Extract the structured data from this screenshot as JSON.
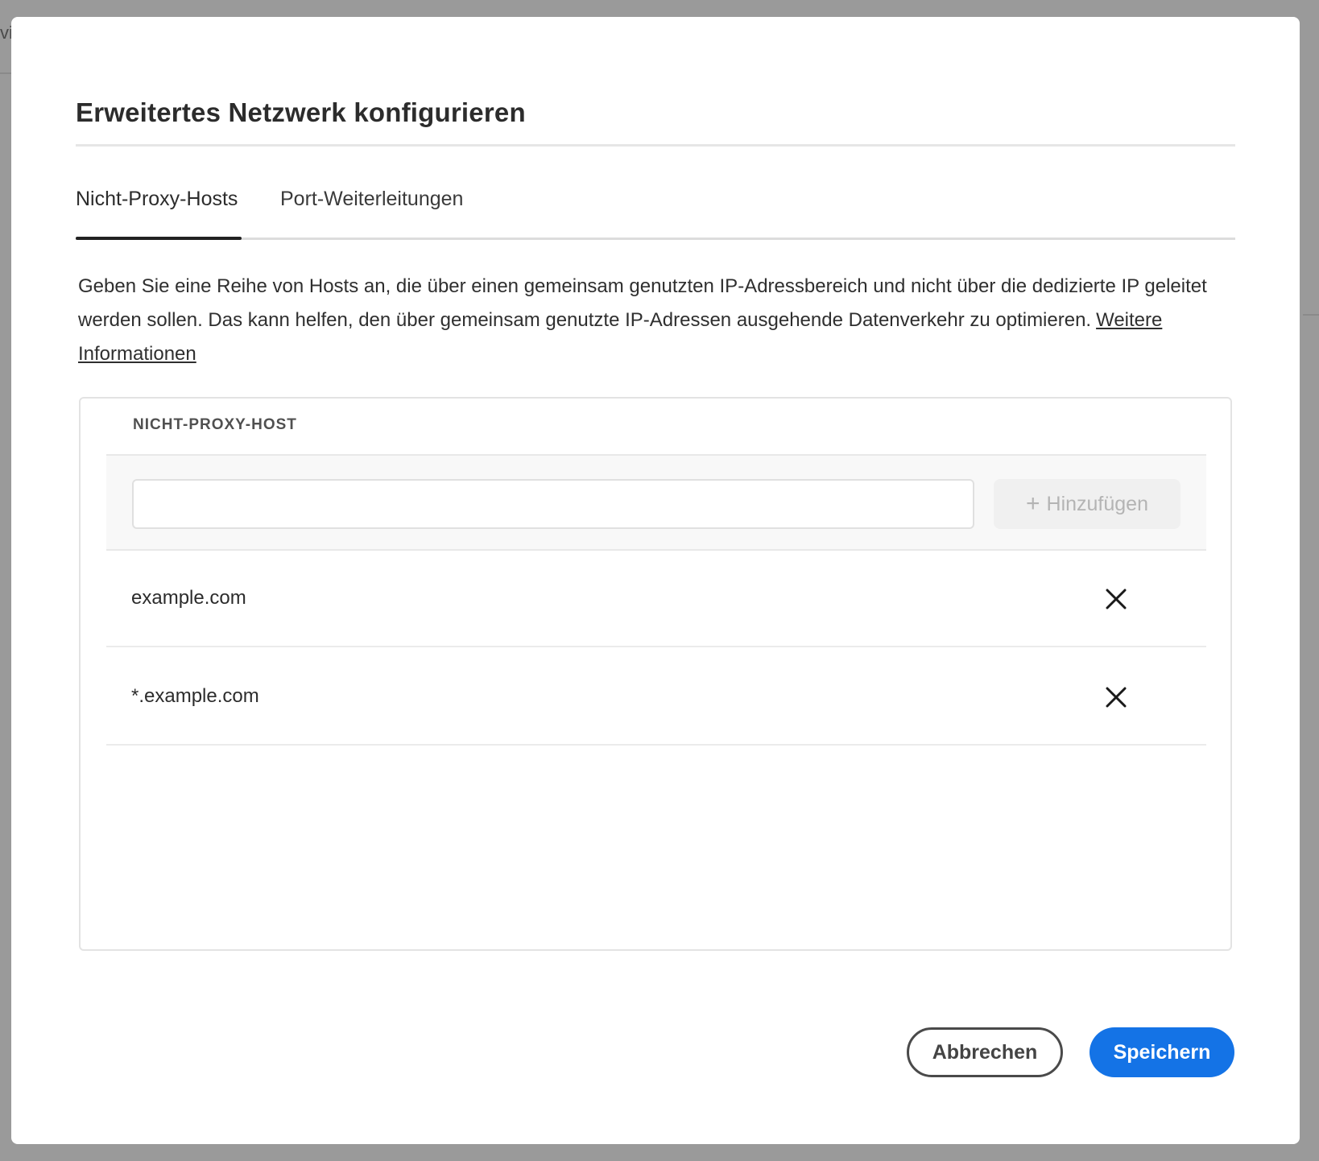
{
  "background": {
    "fragment_text": "vi"
  },
  "dialog": {
    "title": "Erweitertes Netzwerk konfigurieren",
    "tabs": [
      {
        "label": "Nicht-Proxy-Hosts",
        "selected": true
      },
      {
        "label": "Port-Weiterleitungen",
        "selected": false
      }
    ],
    "description": "Geben Sie eine Reihe von Hosts an, die über einen gemeinsam genutzten IP-Adressbereich und nicht über die dedizierte IP geleitet werden sollen. Das kann helfen, den über gemeinsam genutzte IP-Adressen ausgehende Datenverkehr zu optimieren.",
    "learn_more_link": "Weitere Informationen",
    "table": {
      "column_header": "NICHT-PROXY-HOST",
      "input_value": "",
      "input_placeholder": "",
      "add_button_label": "Hinzufügen",
      "add_button_icon": "plus-icon",
      "rows": [
        {
          "host": "example.com",
          "remove_icon": "close-icon"
        },
        {
          "host": "*.example.com",
          "remove_icon": "close-icon"
        }
      ]
    },
    "footer": {
      "cancel_label": "Abbrechen",
      "save_label": "Speichern"
    }
  },
  "colors": {
    "primary_button": "#1473e6",
    "overlay": "#9a9a9a",
    "disabled_text": "#b4b4b4"
  }
}
